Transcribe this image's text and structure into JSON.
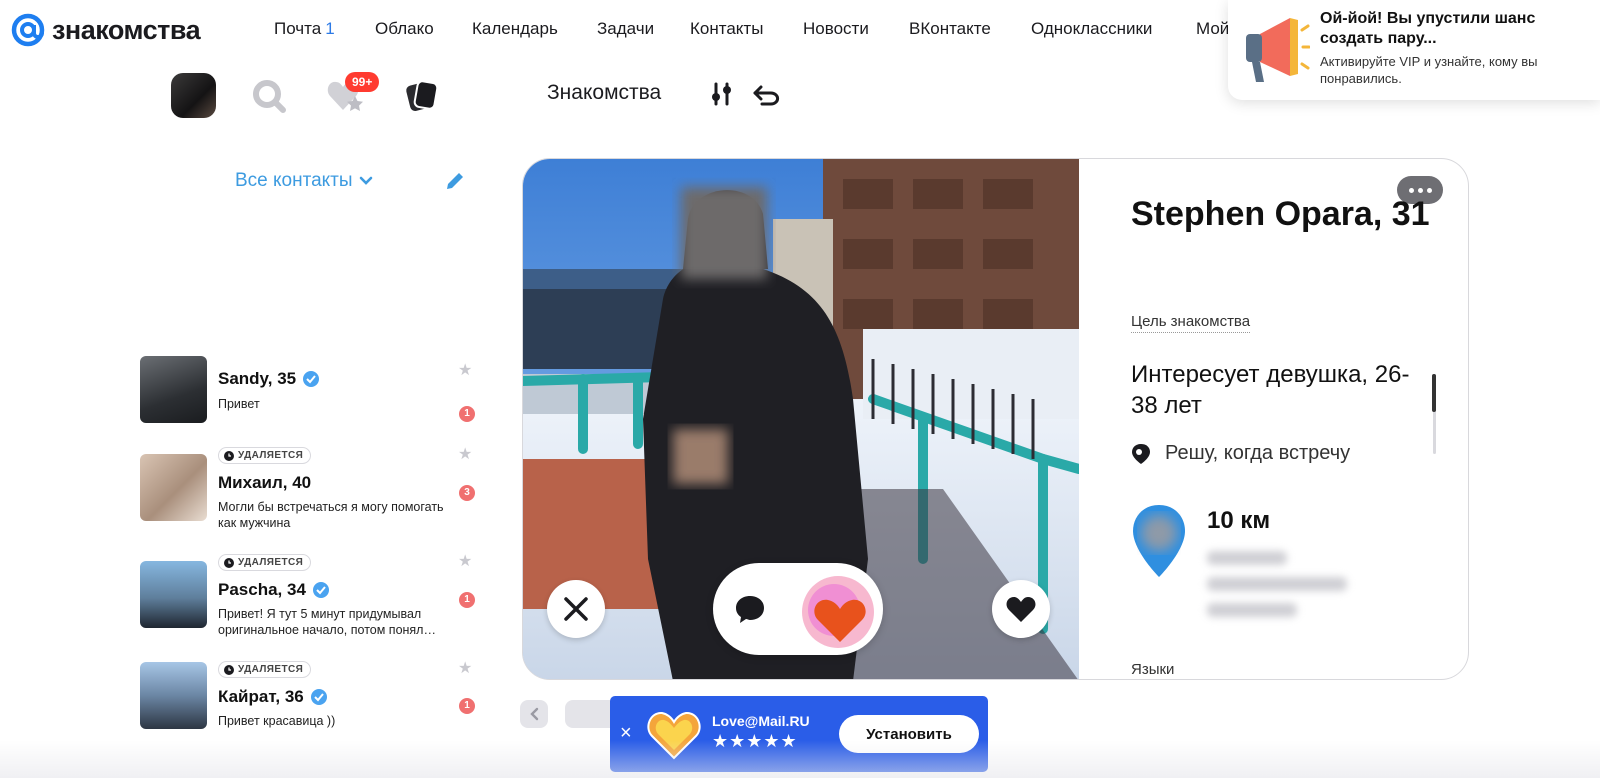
{
  "logo": {
    "text": "знакомства"
  },
  "nav": {
    "mail_label": "Почта",
    "mail_count": "1",
    "items": [
      "Облако",
      "Календарь",
      "Задачи",
      "Контакты",
      "Новости",
      "ВКонтакте",
      "Одноклассники",
      "Мой"
    ]
  },
  "toolbar": {
    "likes_badge": "99+",
    "section_title": "Знакомства"
  },
  "contacts": {
    "filter_label": "Все контакты",
    "items": [
      {
        "name": "Sandy, 35",
        "message": "Привет",
        "tag": "",
        "unread": "1",
        "verified": true
      },
      {
        "name": "Михаил, 40",
        "message": "Могли бы встречаться я могу помогать как мужчина",
        "tag": "УДАЛЯЕТСЯ",
        "unread": "3",
        "verified": false
      },
      {
        "name": "Pascha, 34",
        "message": "Привет! Я тут 5 минут придумывал оригинальное начало, потом понял…",
        "tag": "УДАЛЯЕТСЯ",
        "unread": "1",
        "verified": true
      },
      {
        "name": "Кайрат, 36",
        "message": "Привет красавица ))",
        "tag": "УДАЛЯЕТСЯ",
        "unread": "1",
        "verified": true
      }
    ]
  },
  "profile": {
    "name": "Stephen Opara, 31",
    "goal_label": "Цель знакомства",
    "goal_value": "Интересует девушка, 26-38 лет",
    "meeting": "Решу, когда встречу",
    "distance": "10 км",
    "languages_label": "Языки"
  },
  "app_banner": {
    "title": "Love@Mail.RU",
    "rating": "★★★★★",
    "install_label": "Установить"
  },
  "notification": {
    "title": "Ой-йой! Вы упустили шанс создать пару...",
    "text": "Активируйте VIP и узнайте, кому вы понравились."
  },
  "colors": {
    "accent": "#2c7ae6",
    "link": "#3d9be0",
    "banner": "#2a5de8",
    "badge": "#ff3b30",
    "unread": "#f07070"
  },
  "icons": {
    "logo": "at-sign-icon",
    "search": "search-icon",
    "likes": "heart-star-icon",
    "cards": "cards-icon",
    "filters": "sliders-icon",
    "undo": "undo-icon",
    "edit": "pencil-icon",
    "dislike": "close-icon",
    "chat": "chat-bubble-icon",
    "superlike": "super-heart-icon",
    "like": "heart-icon",
    "meeting": "location-pin-icon"
  }
}
